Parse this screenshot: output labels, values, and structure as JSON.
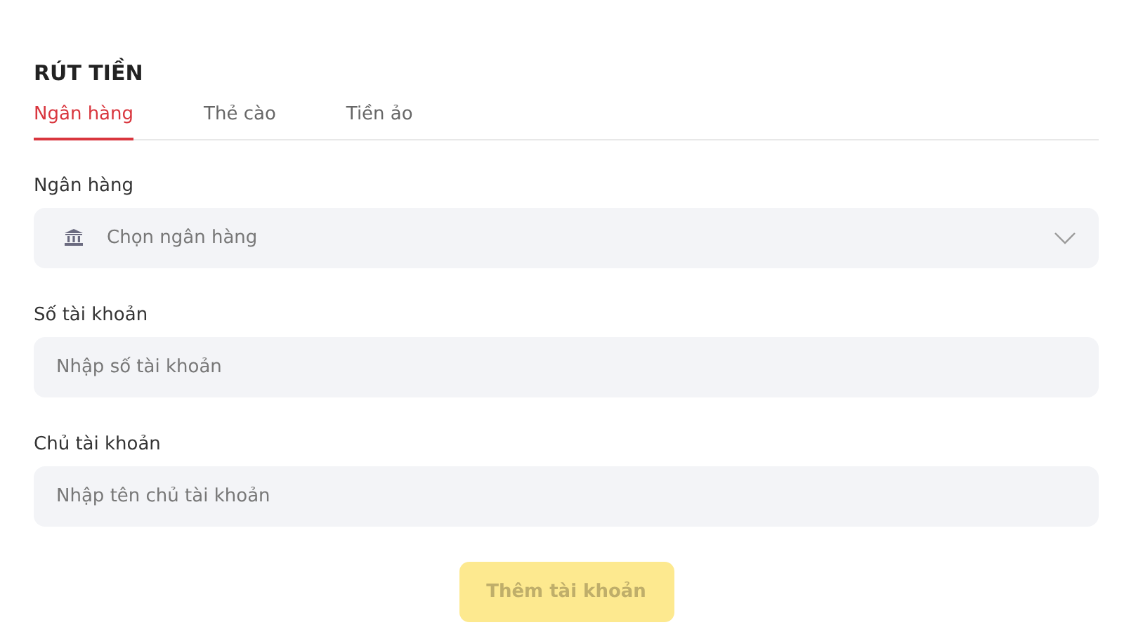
{
  "title": "RÚT TIỀN",
  "tabs": [
    {
      "label": "Ngân hàng",
      "selected": true
    },
    {
      "label": "Thẻ cào",
      "selected": false
    },
    {
      "label": "Tiền ảo",
      "selected": false
    }
  ],
  "fields": [
    {
      "kind": "select",
      "label": "Ngân hàng",
      "placeholder": "Chọn ngân hàng"
    },
    {
      "kind": "text",
      "label": "Số tài khoản",
      "placeholder": "Nhập số tài khoản"
    },
    {
      "kind": "text",
      "label": "Chủ tài khoản",
      "placeholder": "Nhập tên chủ tài khoản"
    }
  ],
  "submit": {
    "label": "Thêm tài khoản",
    "disabled": true
  }
}
